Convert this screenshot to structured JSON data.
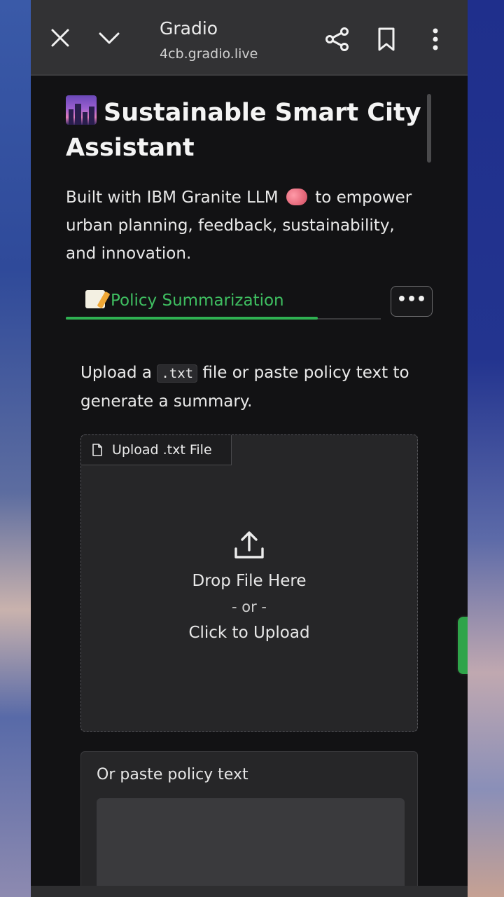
{
  "browser": {
    "title": "Gradio",
    "url": "4cb.gradio.live"
  },
  "app": {
    "title": "Sustainable Smart City Assistant",
    "description_before": "Built with IBM Granite LLM",
    "description_after": "to empower urban planning, feedback, sustainability, and innovation."
  },
  "tabs": {
    "active_label": "Policy Summarization",
    "more_label": "•••"
  },
  "instructions": {
    "before": "Upload a",
    "code": ".txt",
    "after": "file or paste policy text to generate a summary."
  },
  "upload": {
    "label": "Upload .txt File",
    "drop_text": "Drop File Here",
    "or_text": "- or -",
    "click_text": "Click to Upload"
  },
  "paste": {
    "label": "Or paste policy text",
    "value": ""
  },
  "colors": {
    "accent_green": "#3fbf61",
    "background": "#121214",
    "topbar": "#323234"
  }
}
